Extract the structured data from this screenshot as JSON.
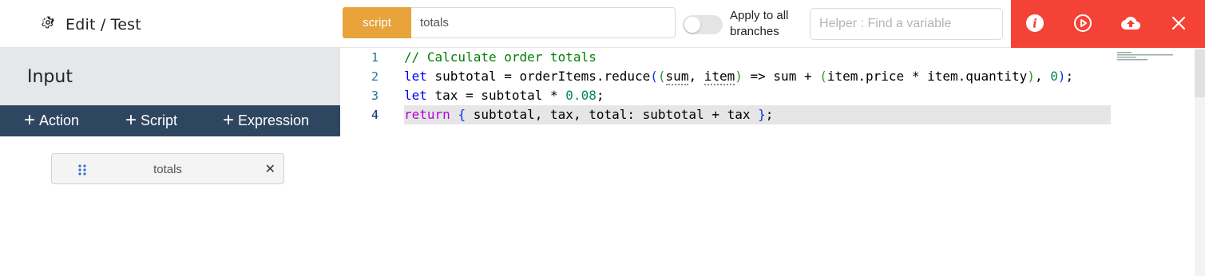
{
  "header": {
    "title": "Edit / Test",
    "type_badge": "script",
    "name_value": "totals",
    "apply_all_branches_label": "Apply to all branches",
    "apply_all_branches_enabled": false,
    "helper_placeholder": "Helper : Find a variable",
    "actions": [
      {
        "icon": "info-icon"
      },
      {
        "icon": "play-icon"
      },
      {
        "icon": "upload-cloud-icon"
      },
      {
        "icon": "close-icon"
      }
    ],
    "colors": {
      "badge": "#E8A33B",
      "action_bar": "#F44336"
    }
  },
  "left_panel": {
    "title": "Input",
    "toolbar": [
      {
        "label": "Action"
      },
      {
        "label": "Script"
      },
      {
        "label": "Expression"
      }
    ],
    "chip": {
      "label": "totals",
      "drag_icon": "drag-handle-icon",
      "close_glyph": "✕"
    },
    "toolbar_color": "#2F4660"
  },
  "editor": {
    "lines": [
      {
        "number": "1",
        "text": "// Calculate order totals"
      },
      {
        "number": "2",
        "text": "let subtotal = orderItems.reduce((sum, item) => sum + (item.price * item.quantity), 0);"
      },
      {
        "number": "3",
        "text": "let tax = subtotal * 0.08;"
      },
      {
        "number": "4",
        "text": "return { subtotal, tax, total: subtotal + tax };"
      }
    ],
    "active_line": 4
  }
}
